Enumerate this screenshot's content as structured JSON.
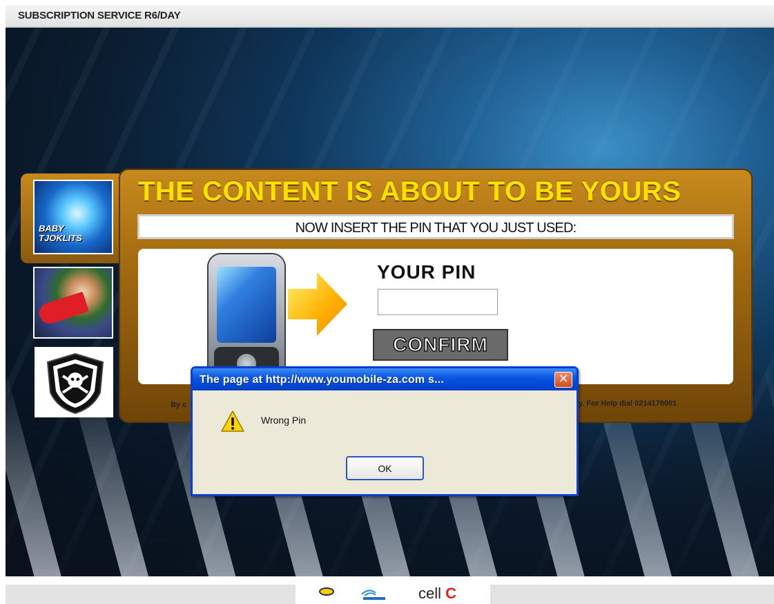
{
  "page": {
    "header_title": "SUBSCRIPTION SERVICE R6/DAY"
  },
  "promo": {
    "headline": "THE CONTENT IS ABOUT TO BE YOURS",
    "instruction": "NOW INSERT THE PIN THAT YOU JUST USED:",
    "pin_label": "YOUR PIN",
    "pin_value": "",
    "confirm_label": "CONFIRM",
    "footnote_left": "By c",
    "footnote_right": "y. For Help dial 0214178001",
    "thumbnail_text_1": "BABY",
    "thumbnail_text_2": "TJOKLITS"
  },
  "alert": {
    "title": "The page at http://www.youmobile-za.com s...",
    "message": "Wrong Pin",
    "ok_label": "OK",
    "close_glyph": "✕"
  },
  "footer": {
    "cellc_text": "cell",
    "cellc_mark": "C"
  },
  "colors": {
    "headline": "#ffe100",
    "panel_gold": "#b87a18",
    "dialog_title_blue": "#0b57e3",
    "dialog_bg": "#ece9d8"
  },
  "icons": [
    "warning-icon",
    "close-icon",
    "arrow-icon",
    "phone-icon",
    "mtn-logo",
    "vodacom-logo",
    "cellc-logo"
  ]
}
